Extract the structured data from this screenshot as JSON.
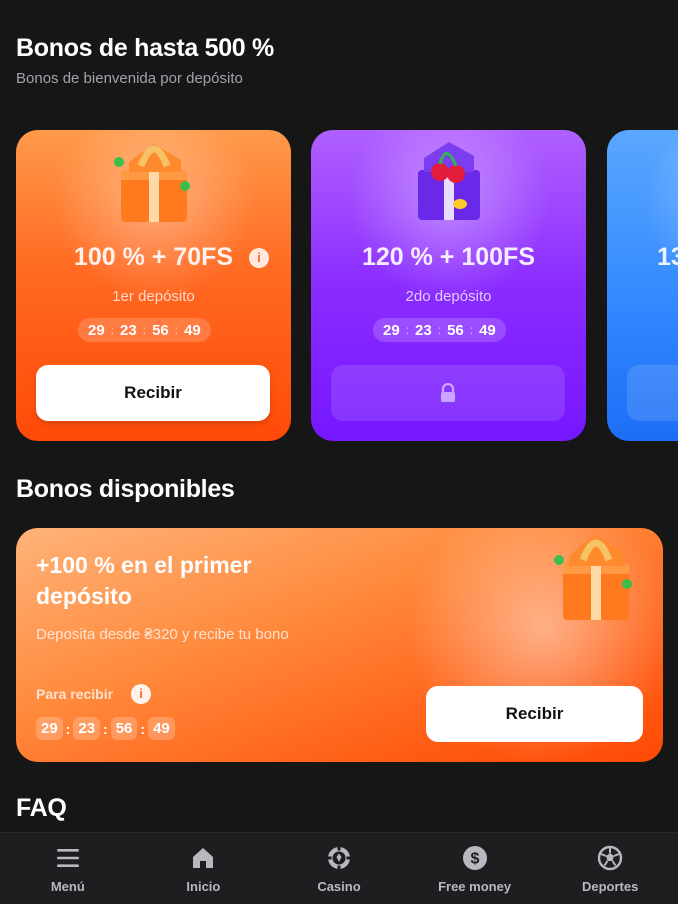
{
  "header": {
    "title": "Bonos de hasta 500 %",
    "subtitle": "Bonos de bienvenida por depósito"
  },
  "carousel": {
    "cards": [
      {
        "amount": "100 % + 70FS",
        "deposit": "1er depósito",
        "timer": [
          "29",
          "23",
          "56",
          "49"
        ],
        "button_label": "Recibir",
        "locked": false,
        "color": "#ff6a22"
      },
      {
        "amount": "120 % + 100FS",
        "deposit": "2do depósito",
        "timer": [
          "29",
          "23",
          "56",
          "49"
        ],
        "locked": true,
        "color": "#8a2cff"
      },
      {
        "amount": "13",
        "color": "#2f86ff"
      }
    ]
  },
  "available": {
    "title": "Bonos disponibles",
    "banner": {
      "title": "+100 % en el primer depósito",
      "description": "Deposita desde ₴320 y recibe tu bono",
      "receive_label": "Para recibir",
      "timer": [
        "29",
        "23",
        "56",
        "49"
      ],
      "button_label": "Recibir"
    }
  },
  "faq": {
    "title": "FAQ"
  },
  "bottom_nav": {
    "items": [
      {
        "label": "Menú",
        "icon": "menu-icon"
      },
      {
        "label": "Inicio",
        "icon": "home-icon"
      },
      {
        "label": "Casino",
        "icon": "casino-chip-icon"
      },
      {
        "label": "Free money",
        "icon": "dollar-coin-icon"
      },
      {
        "label": "Deportes",
        "icon": "soccer-ball-icon"
      }
    ]
  }
}
